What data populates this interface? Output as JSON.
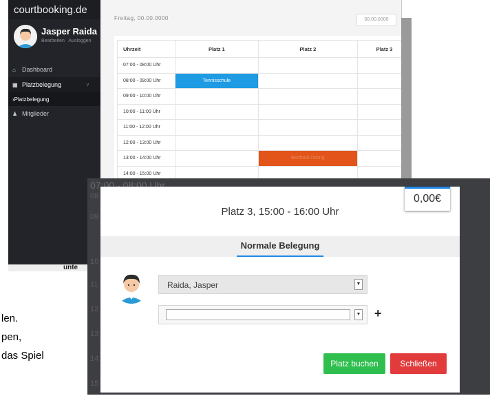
{
  "background_doc": {
    "line1": "len.",
    "line2": "pen,",
    "line3": "das Spiel"
  },
  "sidebar": {
    "brand": "courtbooking.de",
    "user_name": "Jasper Raida",
    "user_links": [
      "Bearbeiten",
      "Ausloggen"
    ],
    "items": [
      {
        "icon": "home-icon",
        "label": "Dashboard"
      },
      {
        "icon": "calendar-icon",
        "label": "Platzbelegung"
      },
      {
        "icon": "chevron-right-icon",
        "label": "Platzbelegung"
      },
      {
        "icon": "person-icon",
        "label": "Mitglieder"
      }
    ],
    "bottom_text": "unte"
  },
  "main": {
    "date_text": "Freitag, 00.00.0000",
    "select_text": "00.00.0000",
    "table": {
      "headers": [
        "Uhrzeit",
        "Platz 1",
        "Platz 2",
        "Platz 3"
      ],
      "rows": [
        [
          "07:00 - 08:00 Uhr",
          "",
          "",
          ""
        ],
        [
          "08:00 - 09:00 Uhr",
          "Tennisschule",
          "",
          ""
        ],
        [
          "09:00 - 10:00 Uhr",
          "",
          "",
          ""
        ],
        [
          "10:00 - 11:00 Uhr",
          "",
          "",
          ""
        ],
        [
          "11:00 - 12:00 Uhr",
          "",
          "",
          ""
        ],
        [
          "12:00 - 13:00 Uhr",
          "",
          "",
          ""
        ],
        [
          "13:00 - 14:00 Uhr",
          "",
          "Berthold Döring",
          ""
        ],
        [
          "14:00 - 15:00 Uhr",
          "",
          "",
          ""
        ]
      ]
    }
  },
  "overlay": {
    "first_time": "07:00 - 08:00 Uhr",
    "time_prefixes": [
      "08",
      "09",
      "10",
      "11",
      "12",
      "13",
      "14",
      "15"
    ]
  },
  "modal": {
    "title": "Platz 3, 15:00 - 16:00 Uhr",
    "price": "0,00€",
    "tab": "Normale Belegung",
    "player1": "Raida, Jasper",
    "player2": "",
    "plus": "+",
    "book_button": "Platz buchen",
    "close_button": "Schließen"
  },
  "colors": {
    "accent": "#1e88e5",
    "event_blue": "#1e9be3",
    "event_red": "#e2541a",
    "book_green": "#2fbf4f",
    "close_red": "#e23b3b",
    "sidebar_bg": "#222429"
  }
}
